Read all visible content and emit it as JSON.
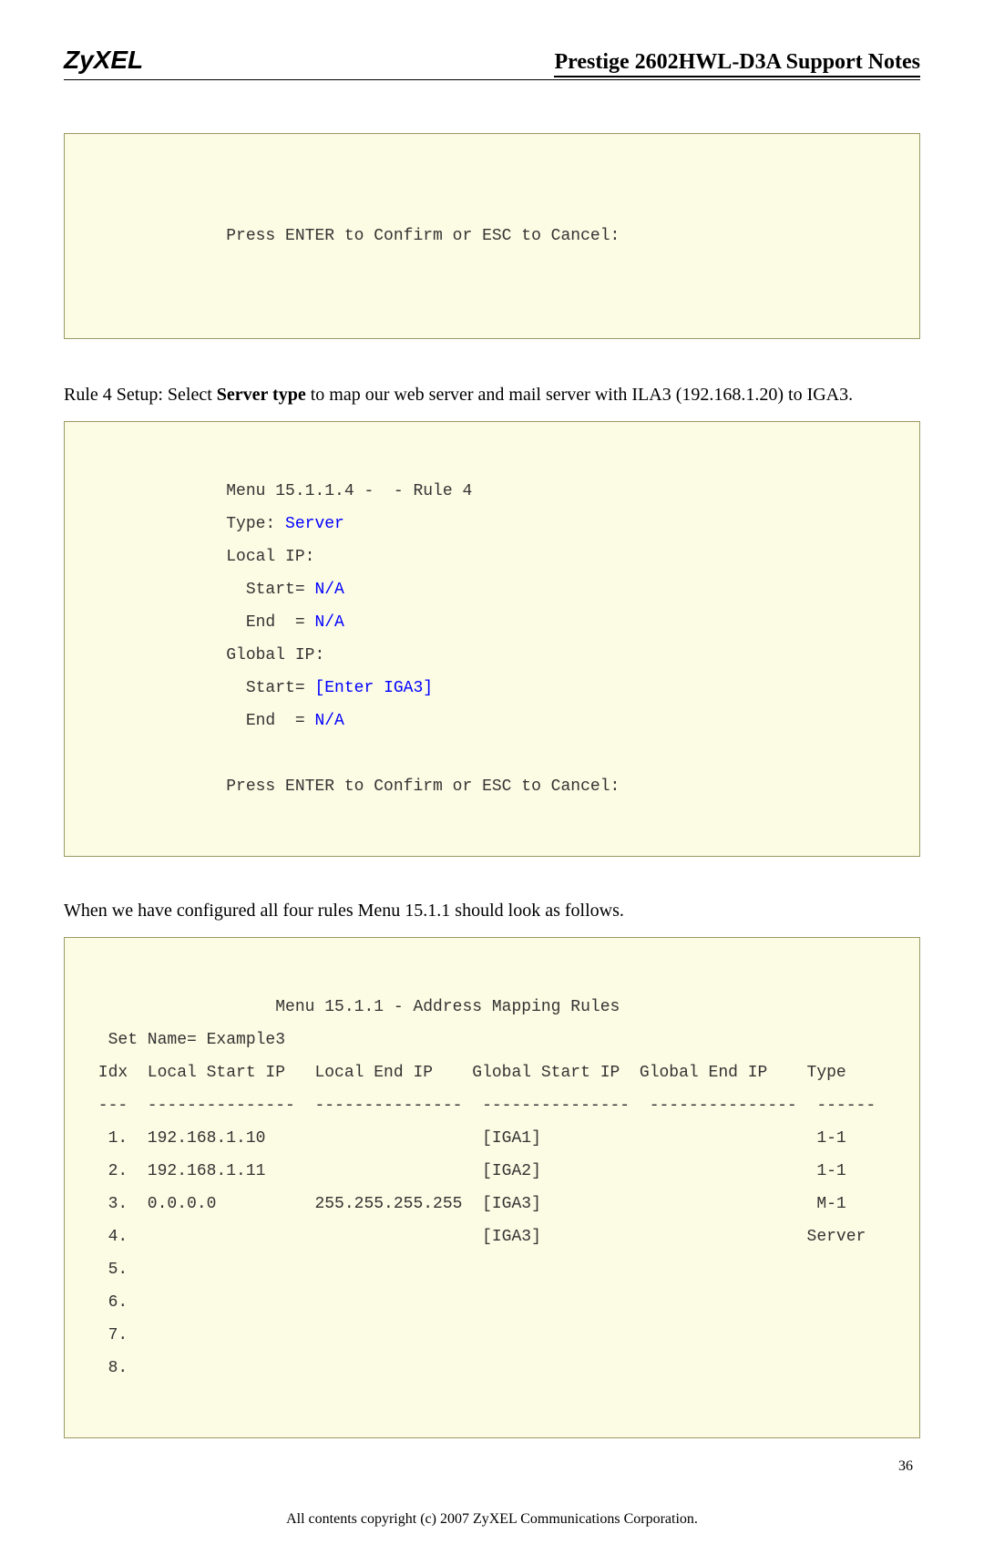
{
  "header": {
    "logo": "ZyXEL",
    "title": "Prestige 2602HWL-D3A Support Notes"
  },
  "box1": {
    "prompt": "              Press ENTER to Confirm or ESC to Cancel:"
  },
  "para1": {
    "prefix": "Rule 4 Setup: Select ",
    "bold": "Server type",
    "suffix": " to map our web server and mail server with ILA3 (192.168.1.20) to IGA3."
  },
  "box2": {
    "l1": "              Menu 15.1.1.4 -  - Rule 4",
    "l2a": "              Type: ",
    "l2b": "Server",
    "l3": "              Local IP:",
    "l4a": "                Start= ",
    "l4b": "N/A",
    "l5a": "                End  = ",
    "l5b": "N/A",
    "l6": "              Global IP:",
    "l7a": "                Start= ",
    "l7b": "[Enter IGA3]",
    "l8a": "                End  = ",
    "l8b": "N/A",
    "l9": "",
    "l10": "              Press ENTER to Confirm or ESC to Cancel:"
  },
  "para2": "When we have configured all four rules Menu 15.1.1 should look as follows.",
  "box3": {
    "l1": "                   Menu 15.1.1 - Address Mapping Rules",
    "l2": "  Set Name= Example3",
    "l3": " Idx  Local Start IP   Local End IP    Global Start IP  Global End IP    Type",
    "l4": " ---  ---------------  ---------------  ---------------  ---------------  ------",
    "l5": "  1.  192.168.1.10                      [IGA1]                            1-1",
    "l6": "  2.  192.168.1.11                      [IGA2]                            1-1",
    "l7": "  3.  0.0.0.0          255.255.255.255  [IGA3]                            M-1",
    "l8": "  4.                                    [IGA3]                           Server",
    "l9": "  5.",
    "l10": "  6.",
    "l11": "  7.",
    "l12": "  8."
  },
  "footer": {
    "page": "36",
    "copyright": "All contents copyright (c) 2007 ZyXEL Communications Corporation."
  }
}
